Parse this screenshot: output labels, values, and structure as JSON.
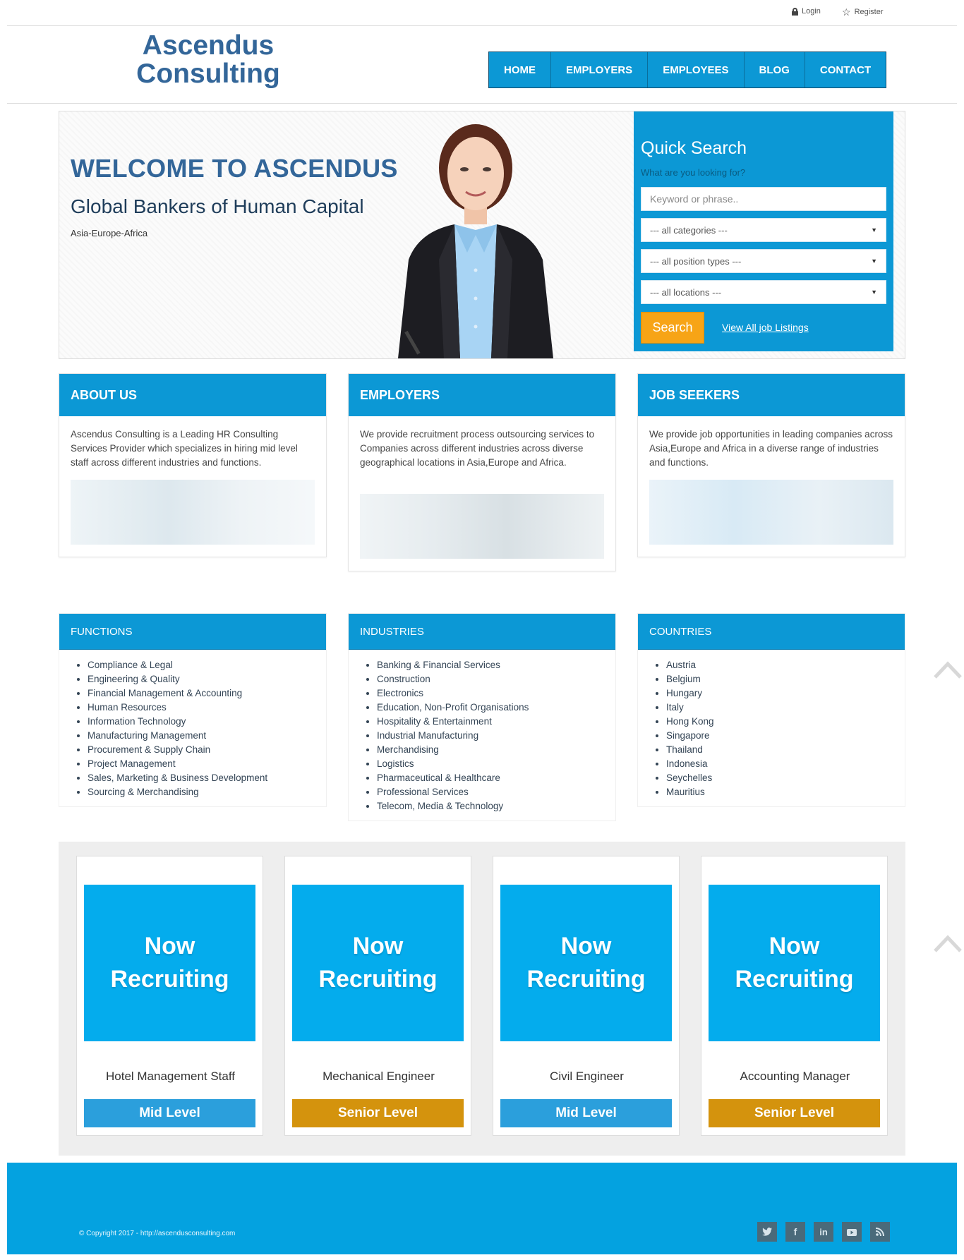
{
  "topbar": {
    "login": "Login",
    "register": "Register"
  },
  "header": {
    "logo_line1": "Ascendus",
    "logo_line2": "Consulting",
    "nav": [
      "HOME",
      "EMPLOYERS",
      "EMPLOYEES",
      "BLOG",
      "CONTACT"
    ]
  },
  "hero": {
    "title": "WELCOME TO ASCENDUS",
    "subtitle": "Global Bankers of Human Capital",
    "region": "Asia-Europe-Africa"
  },
  "quick_search": {
    "title": "Quick Search",
    "hint": "What are you looking for?",
    "keyword_placeholder": "Keyword or phrase..",
    "category": "--- all categories ---",
    "position_type": "--- all position types ---",
    "location": "--- all locations ---",
    "search_button": "Search",
    "view_all": "View All job Listings"
  },
  "panels": [
    {
      "title": "ABOUT US",
      "text": "Ascendus Consulting is a Leading HR Consulting Services Provider which specializes in hiring mid level staff across different industries and functions."
    },
    {
      "title": "EMPLOYERS",
      "text": "We provide recruitment process outsourcing services to Companies across different industries across diverse geographical locations in Asia,Europe and Africa."
    },
    {
      "title": "JOB SEEKERS",
      "text": "We provide job opportunities in leading companies across Asia,Europe and Africa in a diverse range of industries and functions."
    }
  ],
  "lists": {
    "functions": {
      "title": "FUNCTIONS",
      "items": [
        "Compliance & Legal",
        "Engineering & Quality",
        "Financial Management & Accounting",
        "Human Resources",
        "Information Technology",
        "Manufacturing Management",
        "Procurement & Supply Chain",
        "Project Management",
        "Sales, Marketing & Business Development",
        "Sourcing & Merchandising"
      ]
    },
    "industries": {
      "title": "INDUSTRIES",
      "items": [
        "Banking & Financial Services",
        "Construction",
        "Electronics",
        "Education, Non-Profit Organisations",
        "Hospitality & Entertainment",
        "Industrial Manufacturing",
        "Merchandising",
        "Logistics",
        "Pharmaceutical & Healthcare",
        "Professional Services",
        "Telecom, Media & Technology"
      ]
    },
    "countries": {
      "title": "COUNTRIES",
      "items": [
        "Austria",
        "Belgium",
        "Hungary",
        "Italy",
        "Hong Kong",
        "Singapore",
        "Thailand",
        "Indonesia",
        "Seychelles",
        "Mauritius"
      ]
    }
  },
  "jobs": [
    {
      "banner1": "Now",
      "banner2": "Recruiting",
      "title": "Hotel Management Staff",
      "level": "Mid Level",
      "level_color": "#2b9fdc"
    },
    {
      "banner1": "Now",
      "banner2": "Recruiting",
      "title": "Mechanical Engineer",
      "level": "Senior Level",
      "level_color": "#d4930d"
    },
    {
      "banner1": "Now",
      "banner2": "Recruiting",
      "title": "Civil Engineer",
      "level": "Mid Level",
      "level_color": "#2b9fdc"
    },
    {
      "banner1": "Now",
      "banner2": "Recruiting",
      "title": "Accounting Manager",
      "level": "Senior Level",
      "level_color": "#d4930d"
    }
  ],
  "footer": {
    "copyright": "© Copyright 2017 - http://ascendusconsulting.com",
    "social": [
      "twitter-icon",
      "facebook-icon",
      "linkedin-icon",
      "youtube-icon",
      "rss-icon"
    ]
  },
  "colors": {
    "brand_blue": "#0c98d5",
    "logo_blue": "#336699",
    "search_orange": "#f7a416"
  }
}
